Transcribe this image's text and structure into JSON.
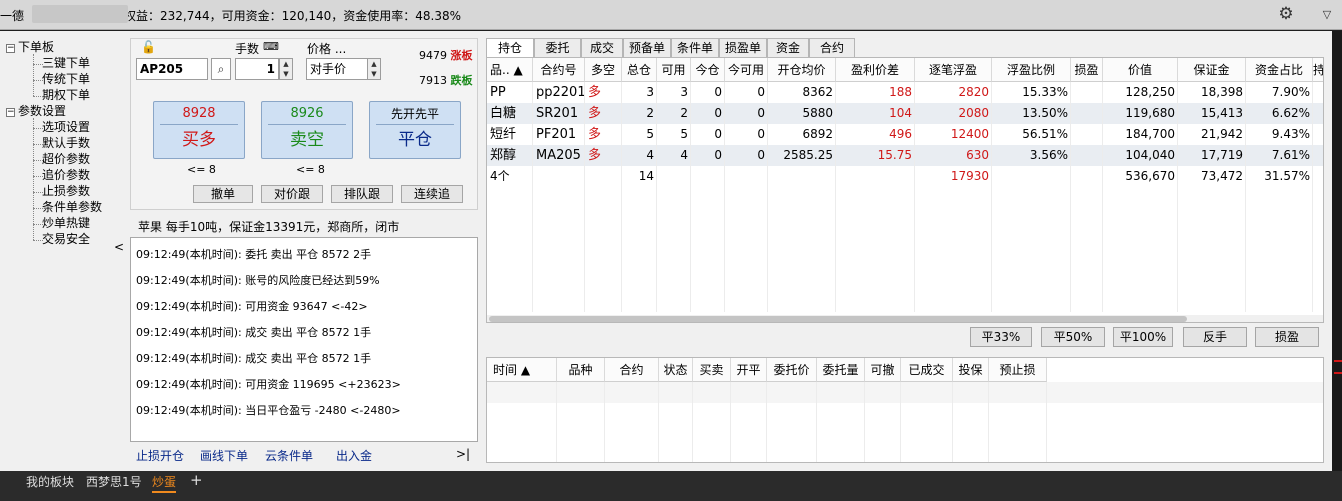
{
  "titlebar": {
    "prefix": "一德",
    "text": "权益：232,744，可用资金：120,140，资金使用率：48.38%"
  },
  "tree": [
    {
      "label": "下单板",
      "level": 0,
      "box": "−"
    },
    {
      "label": "三键下单",
      "level": 1
    },
    {
      "label": "传统下单",
      "level": 1
    },
    {
      "label": "期权下单",
      "level": 1
    },
    {
      "label": "参数设置",
      "level": 0,
      "box": "−"
    },
    {
      "label": "选项设置",
      "level": 1
    },
    {
      "label": "默认手数",
      "level": 1
    },
    {
      "label": "超价参数",
      "level": 1
    },
    {
      "label": "追价参数",
      "level": 1
    },
    {
      "label": "止损参数",
      "level": 1
    },
    {
      "label": "条件单参数",
      "level": 1
    },
    {
      "label": "炒单热键",
      "level": 1
    },
    {
      "label": "交易安全",
      "level": 1
    }
  ],
  "order": {
    "lots_label": "手数",
    "price_label": "价格 ...",
    "contract": "AP205",
    "lots": "1",
    "price_type": "对手价",
    "limit_up": "9479",
    "limit_up_label": "涨板",
    "limit_down": "7913",
    "limit_down_label": "跌板",
    "buy": {
      "price": "8928",
      "label": "买多",
      "note": "<= 8"
    },
    "sell": {
      "price": "8926",
      "label": "卖空",
      "note": "<= 8"
    },
    "close": {
      "top": "先开先平",
      "label": "平仓"
    },
    "buttons": [
      "撤单",
      "对价跟",
      "排队跟",
      "连续追"
    ]
  },
  "info": "苹果  每手10吨，保证金13391元，郑商所，闭市",
  "log": [
    "09:12:49(本机时间): 委托  卖出  平仓  8572  2手",
    "09:12:49(本机时间): 账号的风险度已经达到59%",
    "09:12:49(本机时间): 可用资金 93647  <-42>",
    "09:12:49(本机时间): 成交  卖出  平仓  8572  1手",
    "09:12:49(本机时间): 成交  卖出  平仓  8572  1手",
    "09:12:49(本机时间): 可用资金 119695  <+23623>",
    "09:12:49(本机时间): 当日平仓盈亏 -2480  <-2480>"
  ],
  "bottom_links": [
    "止损开仓",
    "画线下单",
    "云条件单",
    "出入金"
  ],
  "bottom_links_arrow": ">|",
  "collapse_left": "<",
  "tabs": [
    "持仓",
    "委托",
    "成交",
    "预备单",
    "条件单",
    "损盈单",
    "资金",
    "合约"
  ],
  "positions": {
    "headers": [
      "品.. ▲",
      "合约号",
      "多空",
      "总仓",
      "可用",
      "今仓",
      "今可用",
      "开仓均价",
      "盈利价差",
      "逐笔浮盈",
      "浮盈比例",
      "损盈",
      "价值",
      "保证金",
      "资金占比",
      "持"
    ],
    "rows": [
      [
        "PP",
        "pp2201",
        "多",
        "3",
        "3",
        "0",
        "0",
        "8362",
        "188",
        "2820",
        "15.33%",
        "",
        "128,250",
        "18,398",
        "7.90%"
      ],
      [
        "白糖",
        "SR201",
        "多",
        "2",
        "2",
        "0",
        "0",
        "5880",
        "104",
        "2080",
        "13.50%",
        "",
        "119,680",
        "15,413",
        "6.62%"
      ],
      [
        "短纤",
        "PF201",
        "多",
        "5",
        "5",
        "0",
        "0",
        "6892",
        "496",
        "12400",
        "56.51%",
        "",
        "184,700",
        "21,942",
        "9.43%"
      ],
      [
        "郑醇",
        "MA205",
        "多",
        "4",
        "4",
        "0",
        "0",
        "2585.25",
        "15.75",
        "630",
        "3.56%",
        "",
        "104,040",
        "17,719",
        "7.61%"
      ]
    ],
    "total": {
      "label": "4个",
      "qty": "14",
      "float": "17930",
      "value": "536,670",
      "margin": "73,472",
      "ratio": "31.57%"
    }
  },
  "ctrl_buttons": [
    "平33%",
    "平50%",
    "平100%",
    "反手",
    "损盈"
  ],
  "orders": {
    "headers": [
      "时间 ▲",
      "品种",
      "合约",
      "状态",
      "买卖",
      "开平",
      "委托价",
      "委托量",
      "可撤",
      "已成交",
      "投保",
      "预止损"
    ]
  },
  "bottom_tabs": [
    "我的板块",
    "西梦思1号",
    "炒蛋",
    "+"
  ],
  "colors": {
    "red": "#d01818",
    "green": "#1a8a1a",
    "button_blue": "#cfe0f3"
  }
}
